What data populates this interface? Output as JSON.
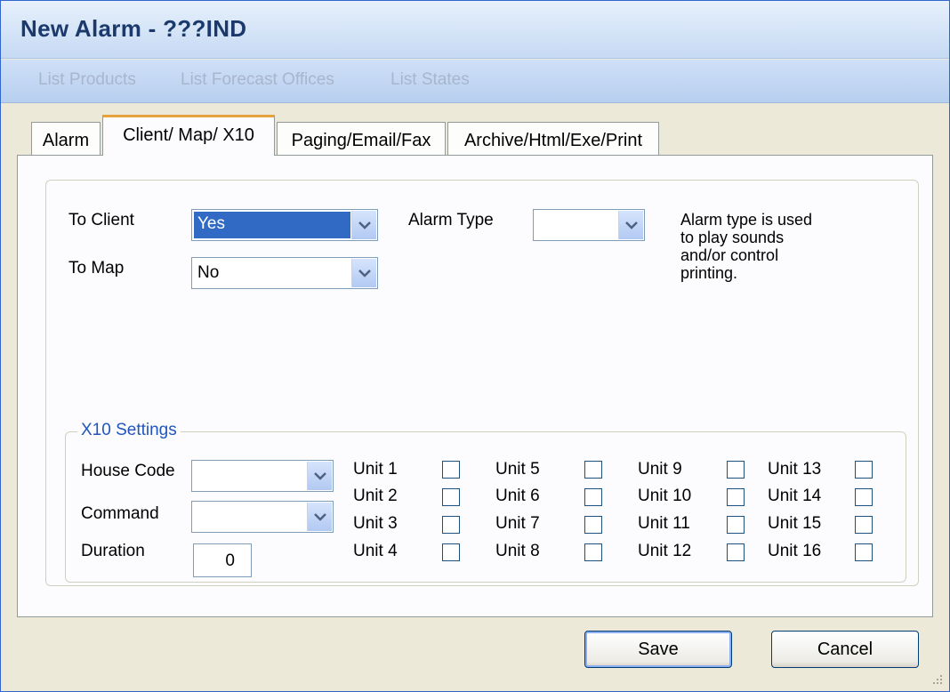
{
  "window": {
    "title": "New Alarm - ???IND"
  },
  "menu": [
    {
      "label": "List Products"
    },
    {
      "label": "List Forecast Offices"
    },
    {
      "label": "List States"
    }
  ],
  "tabs": [
    {
      "label": "Alarm"
    },
    {
      "label": "Client/ Map/ X10"
    },
    {
      "label": "Paging/Email/Fax"
    },
    {
      "label": "Archive/Html/Exe/Print"
    }
  ],
  "client_map": {
    "to_client_label": "To Client",
    "to_client_value": "Yes",
    "to_map_label": "To Map",
    "to_map_value": "No",
    "alarm_type_label": "Alarm Type",
    "alarm_type_value": "",
    "alarm_type_note_1": "Alarm type is used",
    "alarm_type_note_2": "to play sounds",
    "alarm_type_note_3": "and/or control",
    "alarm_type_note_4": "printing."
  },
  "x10": {
    "legend": "X10 Settings",
    "house_code_label": "House Code",
    "house_code_value": "",
    "command_label": "Command",
    "command_value": "",
    "duration_label": "Duration",
    "duration_value": "0",
    "units": [
      "Unit 1",
      "Unit 2",
      "Unit 3",
      "Unit 4",
      "Unit 5",
      "Unit 6",
      "Unit 7",
      "Unit 8",
      "Unit 9",
      "Unit 10",
      "Unit 11",
      "Unit 12",
      "Unit 13",
      "Unit 14",
      "Unit 15",
      "Unit 16"
    ]
  },
  "buttons": {
    "save": "Save",
    "cancel": "Cancel"
  },
  "icons": {
    "dropdown": "chevron-down-icon",
    "resize": "resize-grip-icon"
  },
  "colors": {
    "accent": "#316ac5",
    "tab_highlight": "#e6a23c",
    "group_legend": "#2255bb"
  }
}
